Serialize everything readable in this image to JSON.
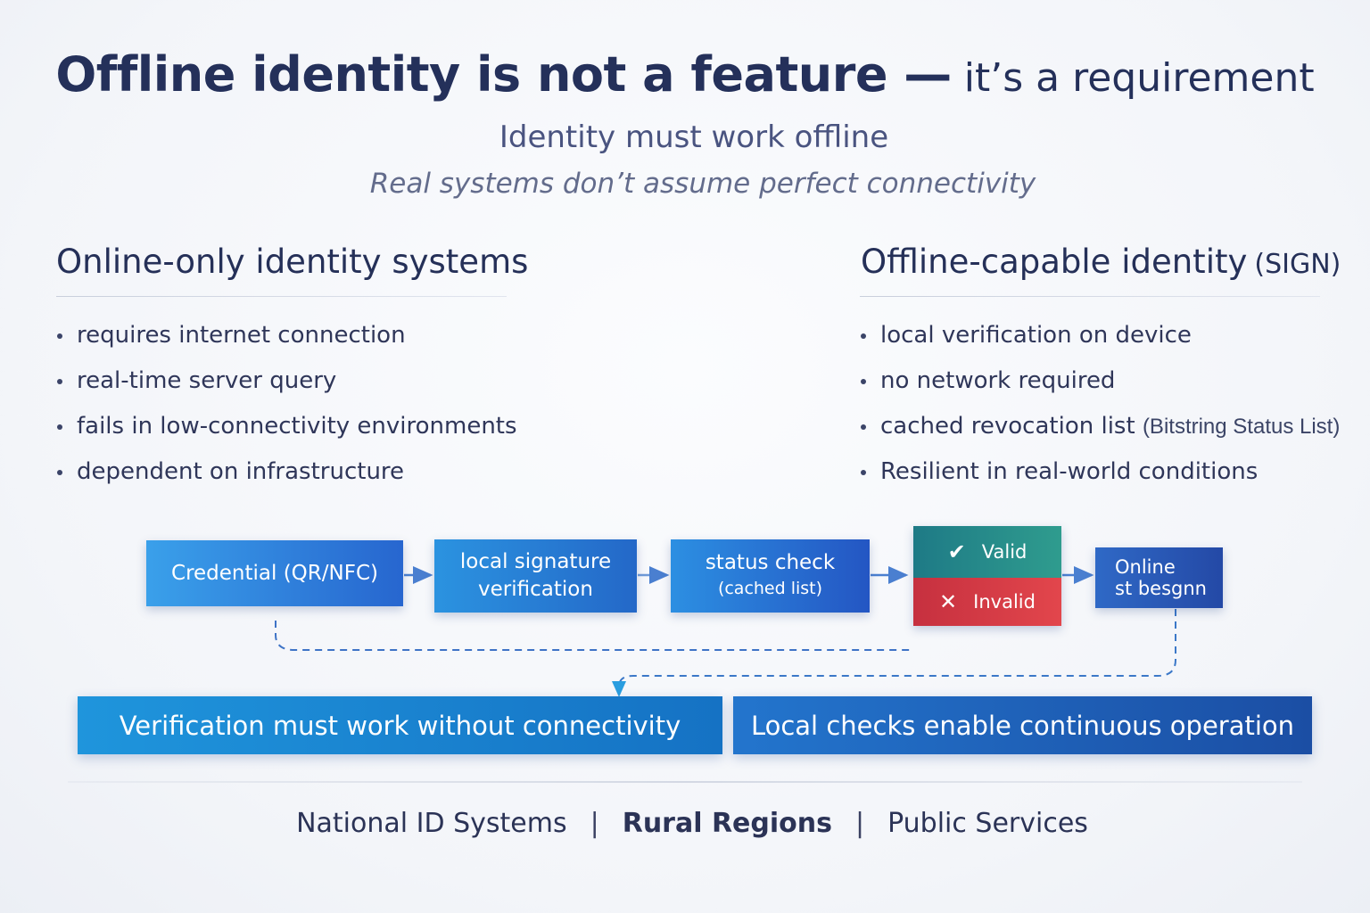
{
  "header": {
    "title_main": "Offline identity is not a feature —",
    "title_rest": "it’s a requirement",
    "subtitle": "Identity must work offline",
    "tagline": "Real systems don’t assume perfect connectivity"
  },
  "left_column": {
    "title": "Online-only identity systems",
    "items": [
      "requires internet connection",
      "real-time server query",
      "fails in low-connectivity environments",
      "dependent on infrastructure"
    ]
  },
  "right_column": {
    "title": "Offline-capable identity",
    "title_suffix": "(SIGN)",
    "items": [
      {
        "text": "local verification on device",
        "note": ""
      },
      {
        "text": "no network required",
        "note": ""
      },
      {
        "text": "cached revocation list",
        "note": "(Bitstring Status List)"
      },
      {
        "text": "Resilient in real-world conditions",
        "note": ""
      }
    ]
  },
  "flow": {
    "credential": "Credential (QR/NFC)",
    "local_sig_line1": "local signature",
    "local_sig_line2": "verification",
    "status_line1": "status check",
    "status_line2": "(cached list)",
    "valid": "Valid",
    "invalid": "Invalid",
    "online_line1": "Online",
    "online_line2": "st besgnn"
  },
  "banners": {
    "left": "Verification must work without connectivity",
    "right": "Local checks enable continuous operation"
  },
  "footer": {
    "item1": "National ID Systems",
    "item2": "Rural Regions",
    "item3": "Public Services",
    "separator": "|"
  },
  "colors": {
    "title": "#24305a",
    "accent_blue": "#2766cf",
    "valid_teal": "#1e7a86",
    "invalid_red": "#d63a44",
    "connector": "#4a7fd0"
  },
  "icons": {
    "valid": "check-icon",
    "invalid": "x-icon",
    "arrow": "arrow-right-icon"
  }
}
